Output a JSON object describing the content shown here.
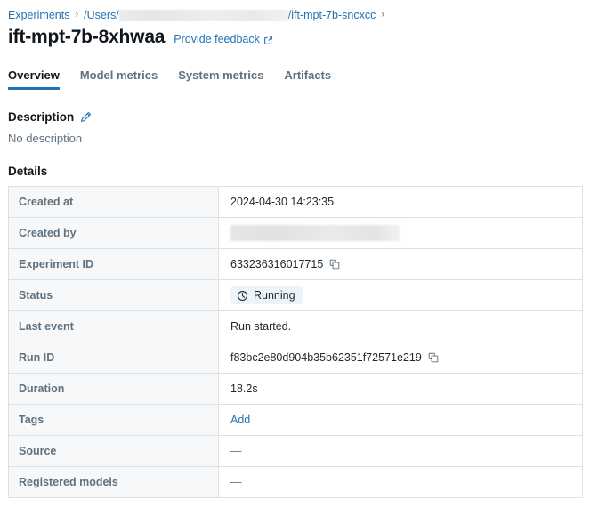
{
  "breadcrumb": {
    "root_label": "Experiments",
    "separator": "›",
    "path_prefix": "/Users/",
    "path_suffix": "/ift-mpt-7b-sncxcc",
    "redacted": true
  },
  "header": {
    "title": "ift-mpt-7b-8xhwaa",
    "feedback_label": "Provide feedback",
    "feedback_icon": "external-link-icon"
  },
  "tabs": [
    {
      "label": "Overview",
      "active": true
    },
    {
      "label": "Model metrics",
      "active": false
    },
    {
      "label": "System metrics",
      "active": false
    },
    {
      "label": "Artifacts",
      "active": false
    }
  ],
  "description": {
    "heading": "Description",
    "edit_icon": "pencil-icon",
    "body": "No description"
  },
  "details": {
    "heading": "Details",
    "rows": [
      {
        "label": "Created at",
        "value": "2024-04-30 14:23:35",
        "type": "text"
      },
      {
        "label": "Created by",
        "value": "",
        "type": "redacted"
      },
      {
        "label": "Experiment ID",
        "value": "633236316017715",
        "type": "copyable"
      },
      {
        "label": "Status",
        "value": "Running",
        "type": "status"
      },
      {
        "label": "Last event",
        "value": "Run started.",
        "type": "text"
      },
      {
        "label": "Run ID",
        "value": "f83bc2e80d904b35b62351f72571e219",
        "type": "copyable"
      },
      {
        "label": "Duration",
        "value": "18.2s",
        "type": "text"
      },
      {
        "label": "Tags",
        "value": "Add",
        "type": "link"
      },
      {
        "label": "Source",
        "value": "—",
        "type": "dash"
      },
      {
        "label": "Registered models",
        "value": "—",
        "type": "dash"
      }
    ],
    "copy_icon": "copy-icon",
    "status_icon": "clock-icon"
  },
  "colors": {
    "link": "#2272b4",
    "accent": "#2272b4",
    "label_text": "#5f7281",
    "border": "#dce0e3",
    "label_bg": "#f7f8f9",
    "badge_bg": "#eef4fb"
  }
}
